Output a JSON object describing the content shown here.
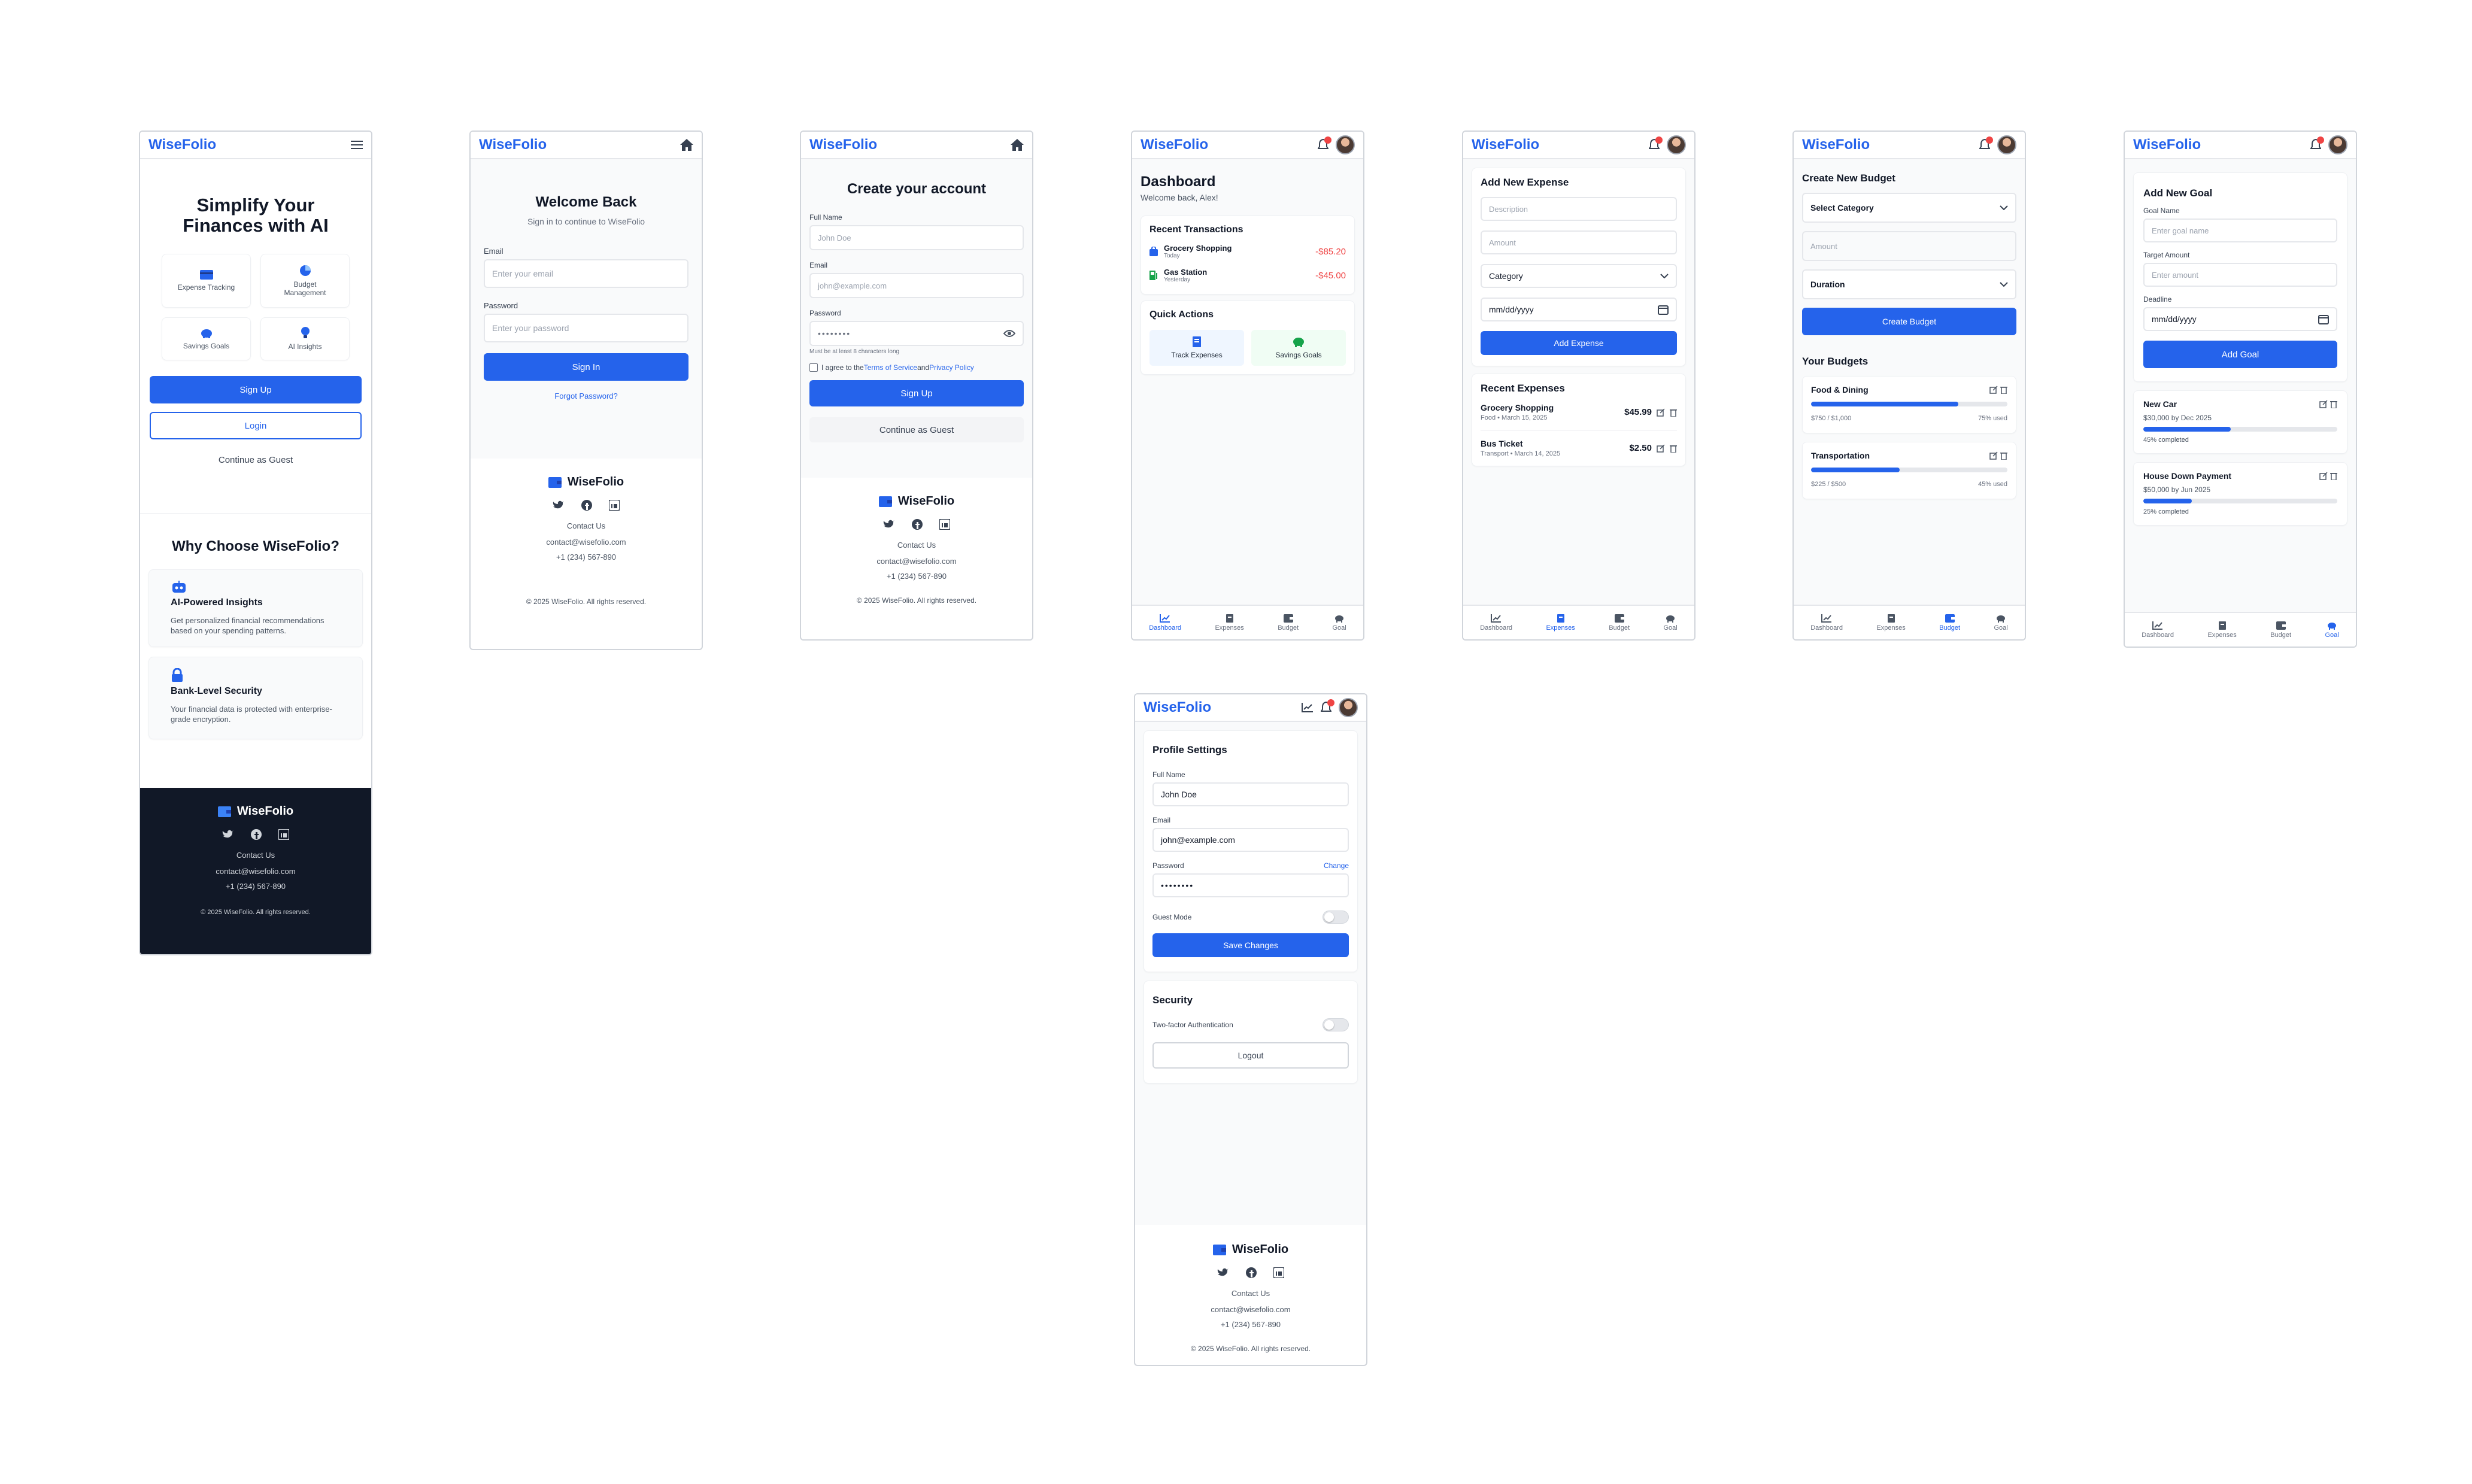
{
  "brand": "WiseFolio",
  "colors": {
    "primary": "#2563eb",
    "danger": "#ef4444",
    "dark": "#111827",
    "success": "#16a34a"
  },
  "landing": {
    "hero_title": "Simplify Your Finances with AI",
    "features": [
      {
        "icon": "credit-card-icon",
        "label": "Expense Tracking"
      },
      {
        "icon": "pie-chart-icon",
        "label": "Budget Management"
      },
      {
        "icon": "piggy-bank-icon",
        "label": "Savings Goals"
      },
      {
        "icon": "lightbulb-icon",
        "label": "AI Insights"
      }
    ],
    "signup_label": "Sign Up",
    "login_label": "Login",
    "guest_label": "Continue as Guest",
    "why_title": "Why Choose WiseFolio?",
    "reasons": [
      {
        "icon": "robot-icon",
        "title": "AI-Powered Insights",
        "text": "Get personalized financial recommendations based on your spending patterns."
      },
      {
        "icon": "lock-icon",
        "title": "Bank-Level Security",
        "text": "Your financial data is protected with enterprise-grade encryption."
      }
    ]
  },
  "footer": {
    "brand": "WiseFolio",
    "contact": "Contact Us",
    "email": "contact@wisefolio.com",
    "phone": "+1 (234) 567-890",
    "copyright": "© 2025 WiseFolio. All rights reserved."
  },
  "signin": {
    "title": "Welcome Back",
    "subtitle": "Sign in to continue to WiseFolio",
    "email_label": "Email",
    "email_placeholder": "Enter your email",
    "password_label": "Password",
    "password_placeholder": "Enter your password",
    "button": "Sign In",
    "forgot": "Forgot Password?"
  },
  "signup": {
    "title": "Create your account",
    "name_label": "Full Name",
    "name_placeholder": "John Doe",
    "email_label": "Email",
    "email_placeholder": "john@example.com",
    "password_label": "Password",
    "password_value": "••••••••",
    "hint": "Must be at least 8 characters long",
    "agree_prefix": "I agree to the",
    "terms": "Terms of Service",
    "and": "and",
    "privacy": "Privacy Policy",
    "button": "Sign Up",
    "guest": "Continue as Guest"
  },
  "nav": [
    "Dashboard",
    "Expenses",
    "Budget",
    "Goal"
  ],
  "dashboard": {
    "title": "Dashboard",
    "welcome": "Welcome back, Alex!",
    "recent_title": "Recent Transactions",
    "transactions": [
      {
        "name": "Grocery Shopping",
        "when": "Today",
        "amount": "-$85.20"
      },
      {
        "name": "Gas Station",
        "when": "Yesterday",
        "amount": "-$45.00"
      }
    ],
    "quick_title": "Quick Actions",
    "quick": [
      "Track Expenses",
      "Savings Goals"
    ]
  },
  "expenses": {
    "form_title": "Add New Expense",
    "description_placeholder": "Description",
    "amount_placeholder": "Amount",
    "category": "Category",
    "date": "mm/dd/yyyy",
    "button": "Add Expense",
    "recent_title": "Recent Expenses",
    "items": [
      {
        "name": "Grocery Shopping",
        "meta": "Food • March 15, 2025",
        "amount": "$45.99"
      },
      {
        "name": "Bus Ticket",
        "meta": "Transport • March 14, 2025",
        "amount": "$2.50"
      }
    ]
  },
  "budget": {
    "form_title": "Create New Budget",
    "category": "Select Category",
    "amount_placeholder": "Amount",
    "duration": "Duration",
    "button": "Create Budget",
    "list_title": "Your Budgets",
    "items": [
      {
        "name": "Food & Dining",
        "spent": "$750 / $1,000",
        "used": "75% used",
        "pct": 75
      },
      {
        "name": "Transportation",
        "spent": "$225 / $500",
        "used": "45% used",
        "pct": 45
      }
    ]
  },
  "goal": {
    "form_title": "Add New Goal",
    "name_label": "Goal Name",
    "name_placeholder": "Enter goal name",
    "target_label": "Target Amount",
    "target_placeholder": "Enter amount",
    "deadline_label": "Deadline",
    "date": "mm/dd/yyyy",
    "button": "Add Goal",
    "items": [
      {
        "name": "New Car",
        "sub": "$30,000 by Dec 2025",
        "done": "45% completed",
        "pct": 45
      },
      {
        "name": "House Down Payment",
        "sub": "$50,000 by Jun 2025",
        "done": "25% completed",
        "pct": 25
      }
    ]
  },
  "profile": {
    "title": "Profile Settings",
    "name_label": "Full Name",
    "name_value": "John Doe",
    "email_label": "Email",
    "email_value": "john@example.com",
    "password_label": "Password",
    "change": "Change",
    "password_value": "••••••••",
    "guest_mode": "Guest Mode",
    "save": "Save Changes",
    "security_title": "Security",
    "two_factor": "Two-factor Authentication",
    "logout": "Logout"
  }
}
